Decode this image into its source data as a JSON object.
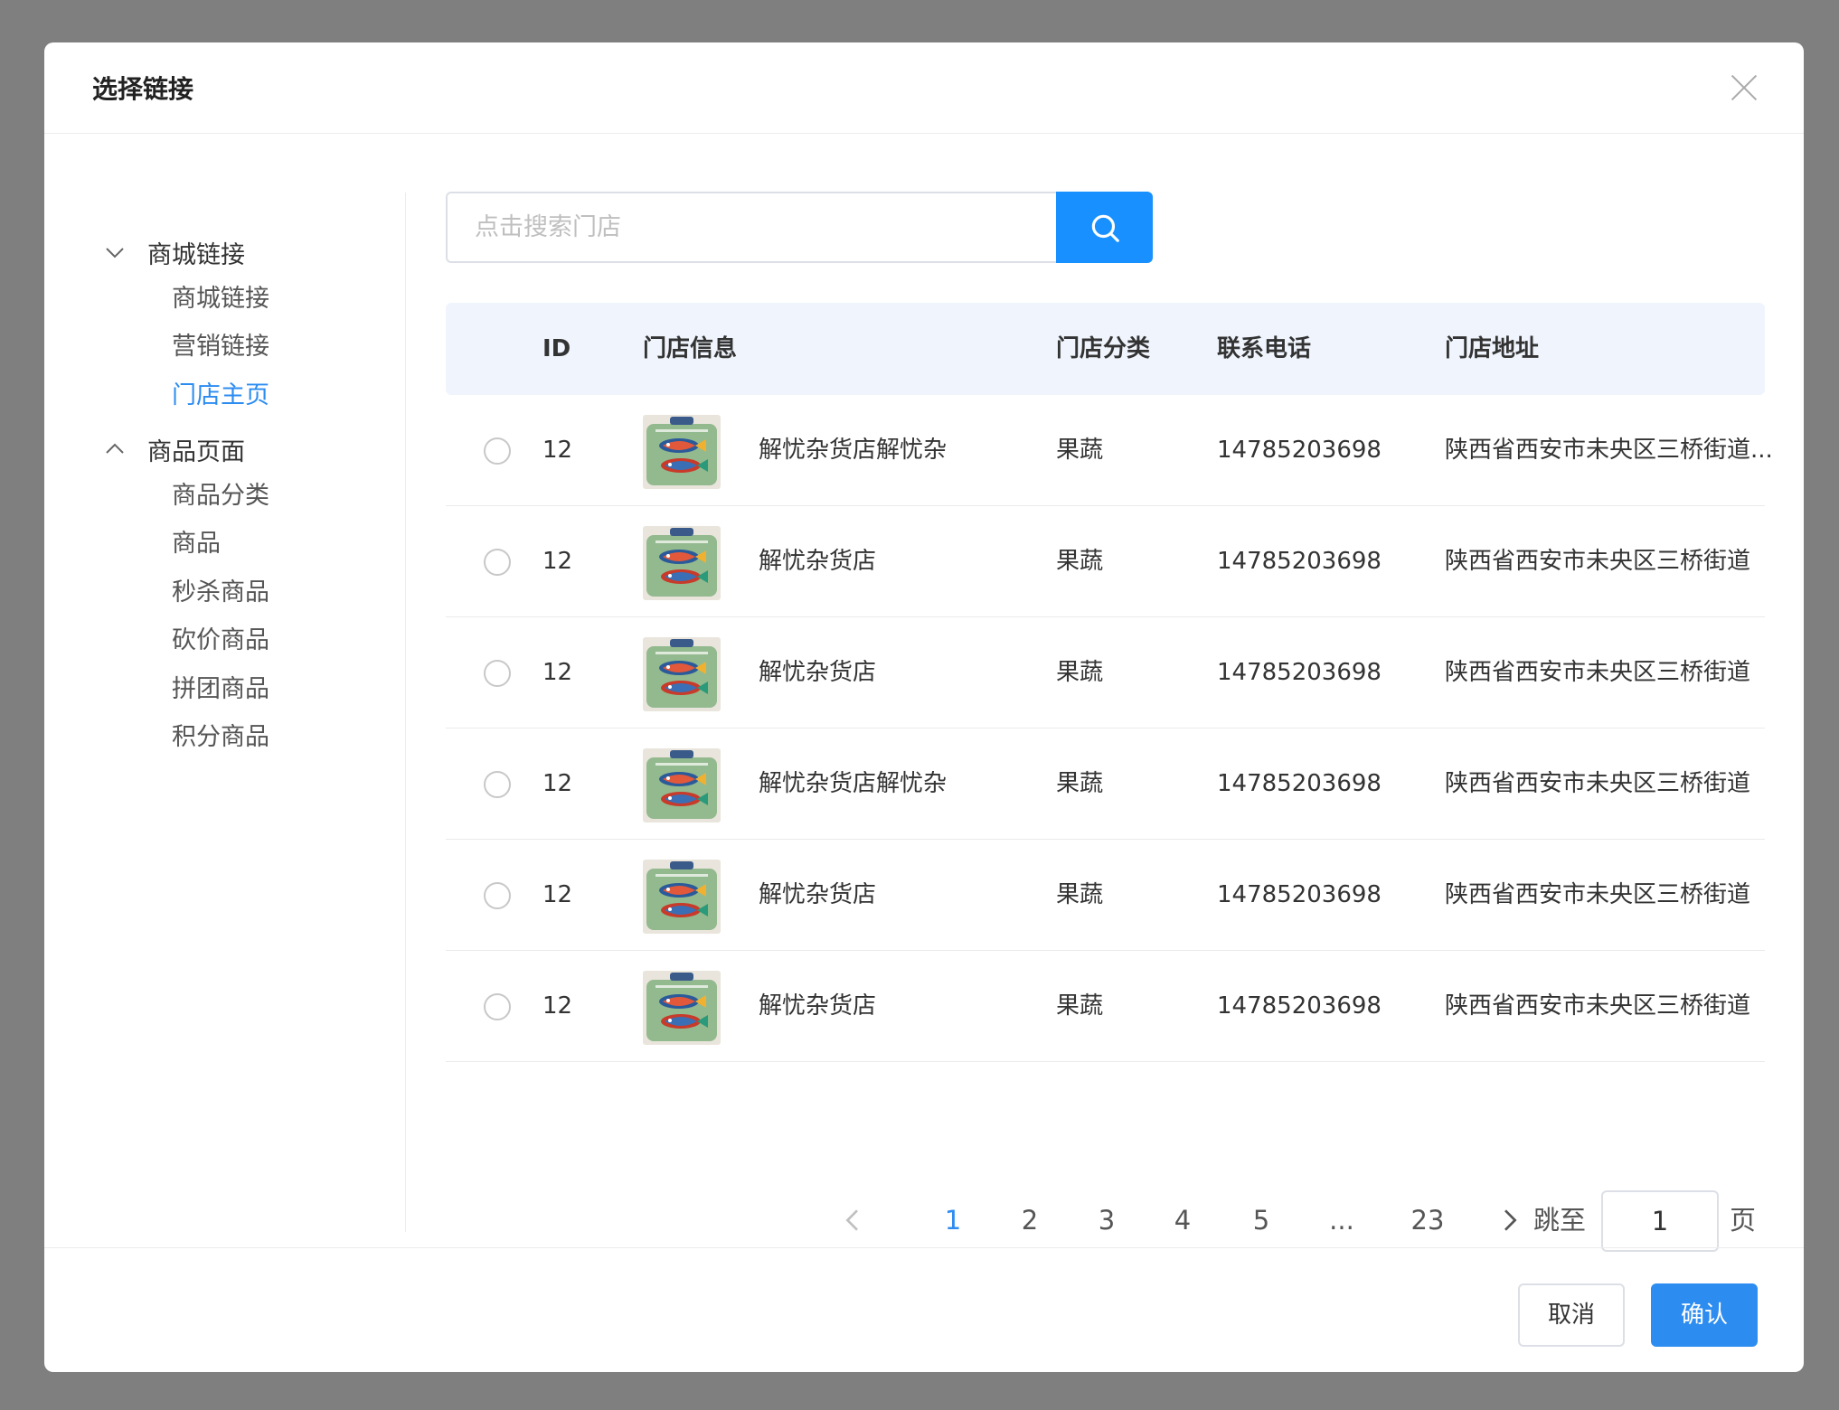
{
  "modal": {
    "title": "选择链接",
    "close_icon": "close-icon"
  },
  "sidebar": {
    "groups": [
      {
        "label": "商城链接",
        "expanded": true,
        "items": [
          {
            "label": "商城链接",
            "active": false
          },
          {
            "label": "营销链接",
            "active": false
          },
          {
            "label": "门店主页",
            "active": true
          }
        ]
      },
      {
        "label": "商品页面",
        "expanded": false,
        "items": [
          {
            "label": "商品分类",
            "active": false
          },
          {
            "label": "商品",
            "active": false
          },
          {
            "label": "秒杀商品",
            "active": false
          },
          {
            "label": "砍价商品",
            "active": false
          },
          {
            "label": "拼团商品",
            "active": false
          },
          {
            "label": "积分商品",
            "active": false
          }
        ]
      }
    ]
  },
  "search": {
    "placeholder": "点击搜索门店",
    "value": "",
    "button_icon": "search-icon"
  },
  "table": {
    "columns": [
      "ID",
      "门店信息",
      "门店分类",
      "联系电话",
      "门店地址"
    ],
    "rows": [
      {
        "id": "12",
        "name": "解忧杂货店解忧杂",
        "category": "果蔬",
        "phone": "14785203698",
        "address": "陕西省西安市未央区三桥街道..."
      },
      {
        "id": "12",
        "name": "解忧杂货店",
        "category": "果蔬",
        "phone": "14785203698",
        "address": "陕西省西安市未央区三桥街道"
      },
      {
        "id": "12",
        "name": "解忧杂货店",
        "category": "果蔬",
        "phone": "14785203698",
        "address": "陕西省西安市未央区三桥街道"
      },
      {
        "id": "12",
        "name": "解忧杂货店解忧杂",
        "category": "果蔬",
        "phone": "14785203698",
        "address": "陕西省西安市未央区三桥街道"
      },
      {
        "id": "12",
        "name": "解忧杂货店",
        "category": "果蔬",
        "phone": "14785203698",
        "address": "陕西省西安市未央区三桥街道"
      },
      {
        "id": "12",
        "name": "解忧杂货店",
        "category": "果蔬",
        "phone": "14785203698",
        "address": "陕西省西安市未央区三桥街道"
      }
    ]
  },
  "pagination": {
    "pages": [
      "1",
      "2",
      "3",
      "4",
      "5",
      "...",
      "23"
    ],
    "current": "1",
    "jump_label": "跳至",
    "jump_value": "1",
    "page_suffix": "页"
  },
  "footer": {
    "cancel_label": "取消",
    "confirm_label": "确认"
  },
  "colors": {
    "accent": "#2d8cf0",
    "search_button": "#1890ff",
    "header_bg": "#f0f5fd"
  }
}
